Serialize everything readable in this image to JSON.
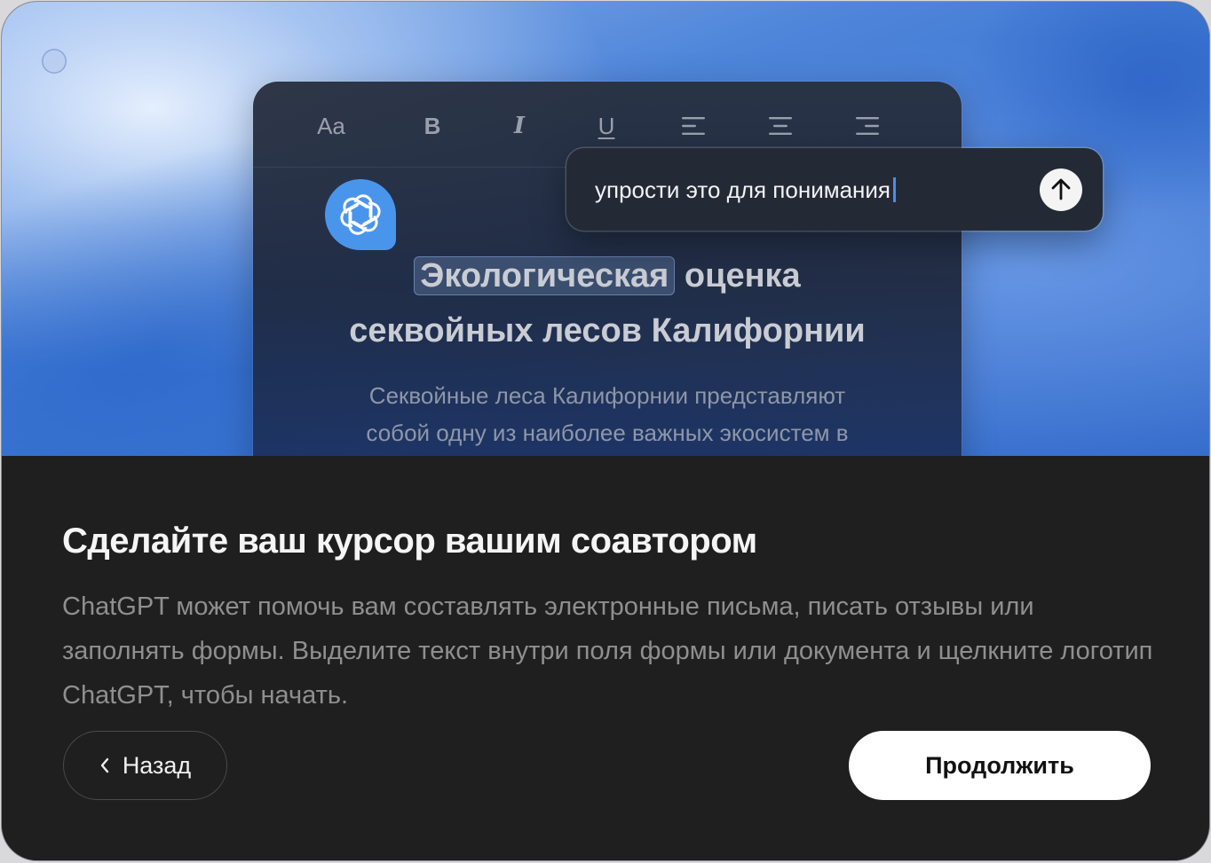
{
  "editor": {
    "toolbar": {
      "font_label": "Aa",
      "bold_label": "B",
      "italic_label": "I",
      "underline_label": "U",
      "align_icons": [
        "align-left-icon",
        "align-center-icon",
        "align-right-icon"
      ]
    },
    "title_highlighted": "Экологическая",
    "title_rest": "оценка",
    "title_line2": "секвойных лесов Калифорнии",
    "body_line1": "Секвойные леса Калифорнии представляют",
    "body_line2": "собой одну из наиболее важных экосистем в",
    "logo_icon": "chatgpt-logo-icon"
  },
  "prompt": {
    "text": "упрости это для понимания",
    "send_icon": "arrow-up-icon"
  },
  "onboarding": {
    "heading": "Сделайте ваш курсор вашим соавтором",
    "description": "ChatGPT может помочь вам составлять электронные письма, писать отзывы или заполнять формы. Выделите текст внутри поля формы или документа и щелкните логотип ChatGPT, чтобы начать.",
    "back_label": "Назад",
    "continue_label": "Продолжить"
  },
  "colors": {
    "accent_blue": "#4a95ec",
    "panel_bg": "#1f1f1f",
    "button_primary_bg": "#ffffff"
  }
}
